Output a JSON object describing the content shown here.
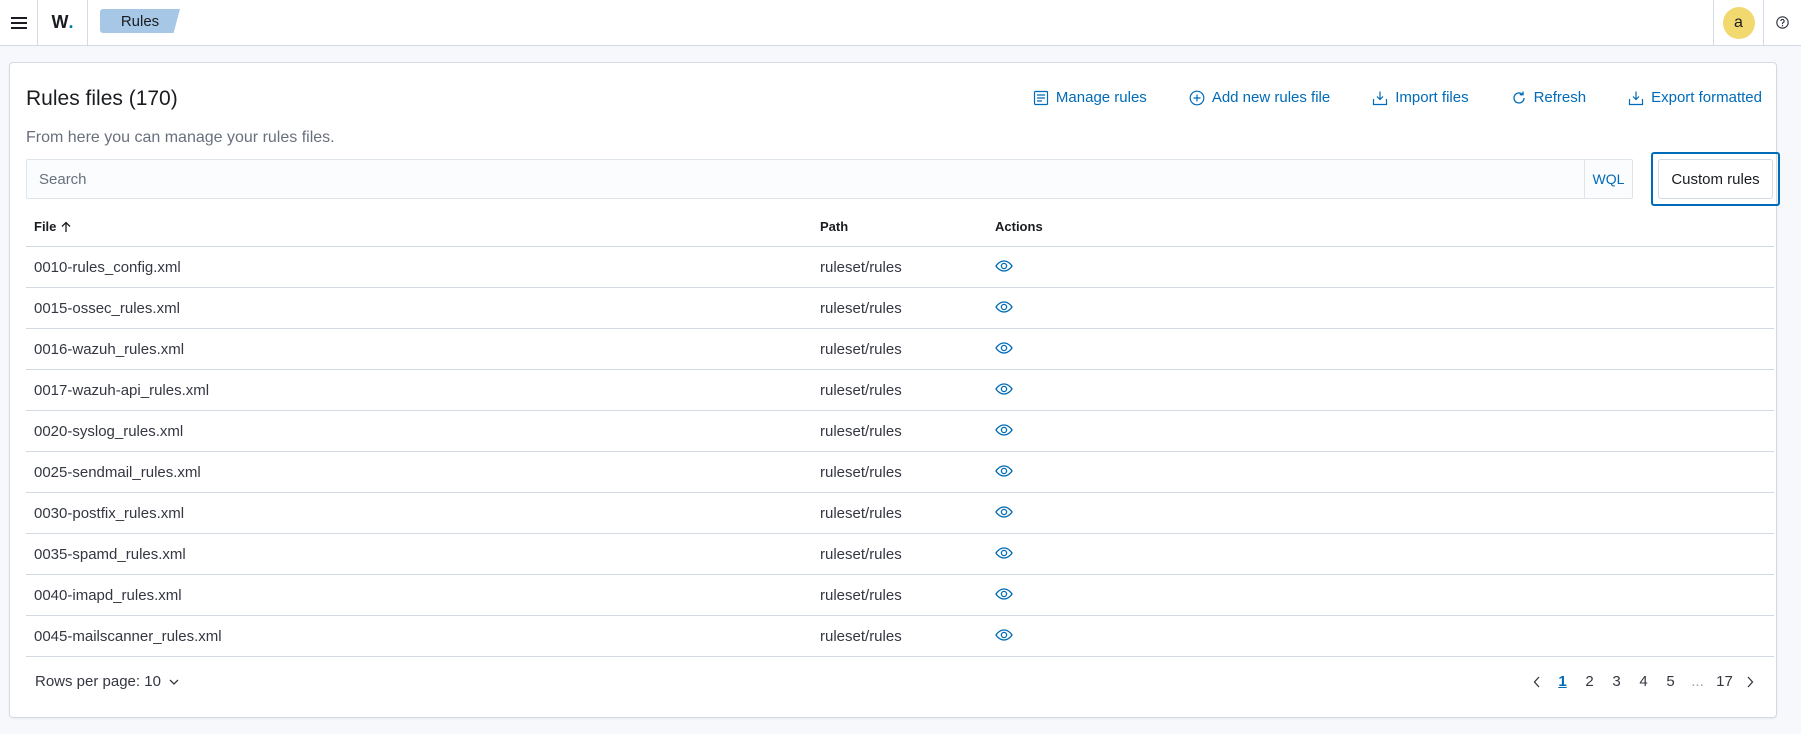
{
  "header": {
    "logo_text": "W",
    "logo_dot": ".",
    "breadcrumb": "Rules",
    "avatar_initial": "a"
  },
  "panel": {
    "title": "Rules files (170)",
    "subtitle": "From here you can manage your rules files.",
    "actions": [
      {
        "label": "Manage rules",
        "icon": "list-icon"
      },
      {
        "label": "Add new rules file",
        "icon": "plus-circle-icon"
      },
      {
        "label": "Import files",
        "icon": "import-icon"
      },
      {
        "label": "Refresh",
        "icon": "refresh-icon"
      },
      {
        "label": "Export formatted",
        "icon": "export-icon"
      }
    ],
    "search": {
      "placeholder": "Search",
      "wql_label": "WQL"
    },
    "custom_rules_label": "Custom rules"
  },
  "table": {
    "columns": {
      "file": "File",
      "path": "Path",
      "actions": "Actions"
    },
    "rows": [
      {
        "file": "0010-rules_config.xml",
        "path": "ruleset/rules"
      },
      {
        "file": "0015-ossec_rules.xml",
        "path": "ruleset/rules"
      },
      {
        "file": "0016-wazuh_rules.xml",
        "path": "ruleset/rules"
      },
      {
        "file": "0017-wazuh-api_rules.xml",
        "path": "ruleset/rules"
      },
      {
        "file": "0020-syslog_rules.xml",
        "path": "ruleset/rules"
      },
      {
        "file": "0025-sendmail_rules.xml",
        "path": "ruleset/rules"
      },
      {
        "file": "0030-postfix_rules.xml",
        "path": "ruleset/rules"
      },
      {
        "file": "0035-spamd_rules.xml",
        "path": "ruleset/rules"
      },
      {
        "file": "0040-imapd_rules.xml",
        "path": "ruleset/rules"
      },
      {
        "file": "0045-mailscanner_rules.xml",
        "path": "ruleset/rules"
      }
    ]
  },
  "footer": {
    "rows_per_page": "Rows per page: 10",
    "pages": [
      "1",
      "2",
      "3",
      "4",
      "5"
    ],
    "ellipsis": "...",
    "last_page": "17",
    "current_page": "1"
  },
  "colors": {
    "accent": "#006bb8",
    "breadcrumb_bg": "#a6c8e6",
    "avatar_bg": "#f1d86f"
  }
}
